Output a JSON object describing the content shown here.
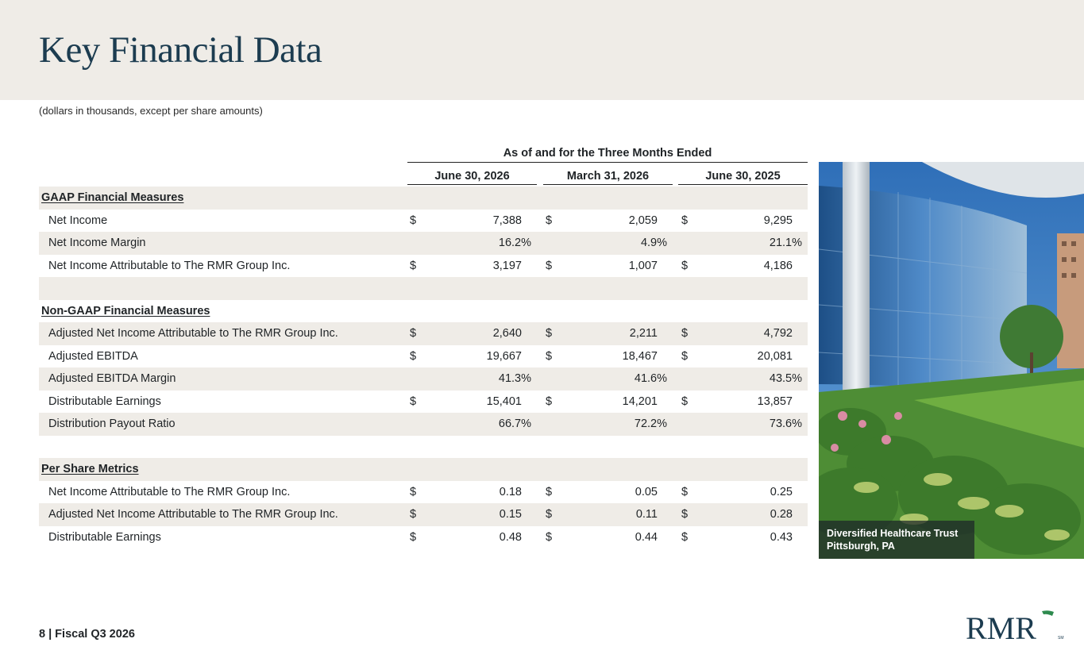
{
  "header": {
    "title": "Key Financial Data",
    "subtitle": "(dollars in thousands, except per share amounts)"
  },
  "table": {
    "group_header": "As of and for the Three Months Ended",
    "columns": [
      "June 30, 2026",
      "March 31, 2026",
      "June 30, 2025"
    ],
    "rows": [
      {
        "type": "section",
        "label": "GAAP Financial Measures",
        "shade": true
      },
      {
        "type": "data",
        "label": "Net Income",
        "dollar": true,
        "values": [
          "7,388",
          "2,059",
          "9,295"
        ],
        "shade": false
      },
      {
        "type": "data",
        "label": "Net Income Margin",
        "dollar": false,
        "values": [
          "16.2%",
          "4.9%",
          "21.1%"
        ],
        "shade": true
      },
      {
        "type": "data",
        "label": "Net Income Attributable to The RMR Group Inc.",
        "dollar": true,
        "values": [
          "3,197",
          "1,007",
          "4,186"
        ],
        "shade": false
      },
      {
        "type": "blank",
        "label": "",
        "shade": true
      },
      {
        "type": "section",
        "label": "Non-GAAP Financial Measures",
        "shade": false
      },
      {
        "type": "data",
        "label": "Adjusted Net Income Attributable to The RMR Group Inc.",
        "dollar": true,
        "values": [
          "2,640",
          "2,211",
          "4,792"
        ],
        "shade": true
      },
      {
        "type": "data",
        "label": "Adjusted EBITDA",
        "dollar": true,
        "values": [
          "19,667",
          "18,467",
          "20,081"
        ],
        "shade": false
      },
      {
        "type": "data",
        "label": "Adjusted EBITDA Margin",
        "dollar": false,
        "values": [
          "41.3%",
          "41.6%",
          "43.5%"
        ],
        "shade": true
      },
      {
        "type": "data",
        "label": "Distributable Earnings",
        "dollar": true,
        "values": [
          "15,401",
          "14,201",
          "13,857"
        ],
        "shade": false
      },
      {
        "type": "data",
        "label": "Distribution Payout Ratio",
        "dollar": false,
        "values": [
          "66.7%",
          "72.2%",
          "73.6%"
        ],
        "shade": true
      },
      {
        "type": "blank",
        "label": "",
        "shade": false
      },
      {
        "type": "section",
        "label": "Per Share Metrics",
        "shade": true
      },
      {
        "type": "data",
        "label": "Net Income Attributable to The RMR Group Inc.",
        "dollar": true,
        "values": [
          "0.18",
          "0.05",
          "0.25"
        ],
        "shade": false
      },
      {
        "type": "data",
        "label": "Adjusted Net Income Attributable to The RMR Group Inc.",
        "dollar": true,
        "values": [
          "0.15",
          "0.11",
          "0.28"
        ],
        "shade": true
      },
      {
        "type": "data",
        "label": "Distributable Earnings",
        "dollar": true,
        "values": [
          "0.48",
          "0.44",
          "0.43"
        ],
        "shade": false
      }
    ]
  },
  "photo": {
    "caption_line1": "Diversified Healthcare Trust",
    "caption_line2": "Pittsburgh, PA"
  },
  "footer": {
    "page_label": "8 | Fiscal Q3 2026"
  },
  "logo": {
    "text": "RMR",
    "mark": "SM",
    "text_color": "#1c3c50",
    "accent_color": "#2e8a4e"
  },
  "colors": {
    "band": "#efece7",
    "title": "#1c3c50"
  }
}
